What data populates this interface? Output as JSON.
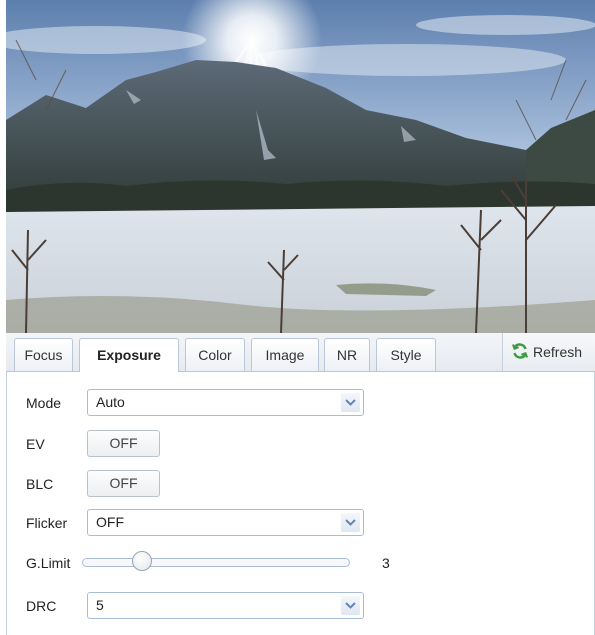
{
  "tabs": [
    {
      "label": "Focus"
    },
    {
      "label": "Exposure"
    },
    {
      "label": "Color"
    },
    {
      "label": "Image"
    },
    {
      "label": "NR"
    },
    {
      "label": "Style"
    }
  ],
  "active_tab": "Exposure",
  "refresh": {
    "label": "Refresh",
    "icon": "refresh-icon",
    "icon_color": "#3e9a3e"
  },
  "exposure": {
    "mode": {
      "label": "Mode",
      "value": "Auto"
    },
    "ev": {
      "label": "EV",
      "value": "OFF"
    },
    "blc": {
      "label": "BLC",
      "value": "OFF"
    },
    "flicker": {
      "label": "Flicker",
      "value": "OFF"
    },
    "g_limit": {
      "label": "G.Limit",
      "value": "3",
      "slider_fraction": 0.2
    },
    "drc": {
      "label": "DRC",
      "value": "5"
    }
  },
  "preview": {
    "description_icon": "camera-preview"
  },
  "colors": {
    "accent_border": "#a9bcd6",
    "tab_border": "#b9c7d8"
  }
}
